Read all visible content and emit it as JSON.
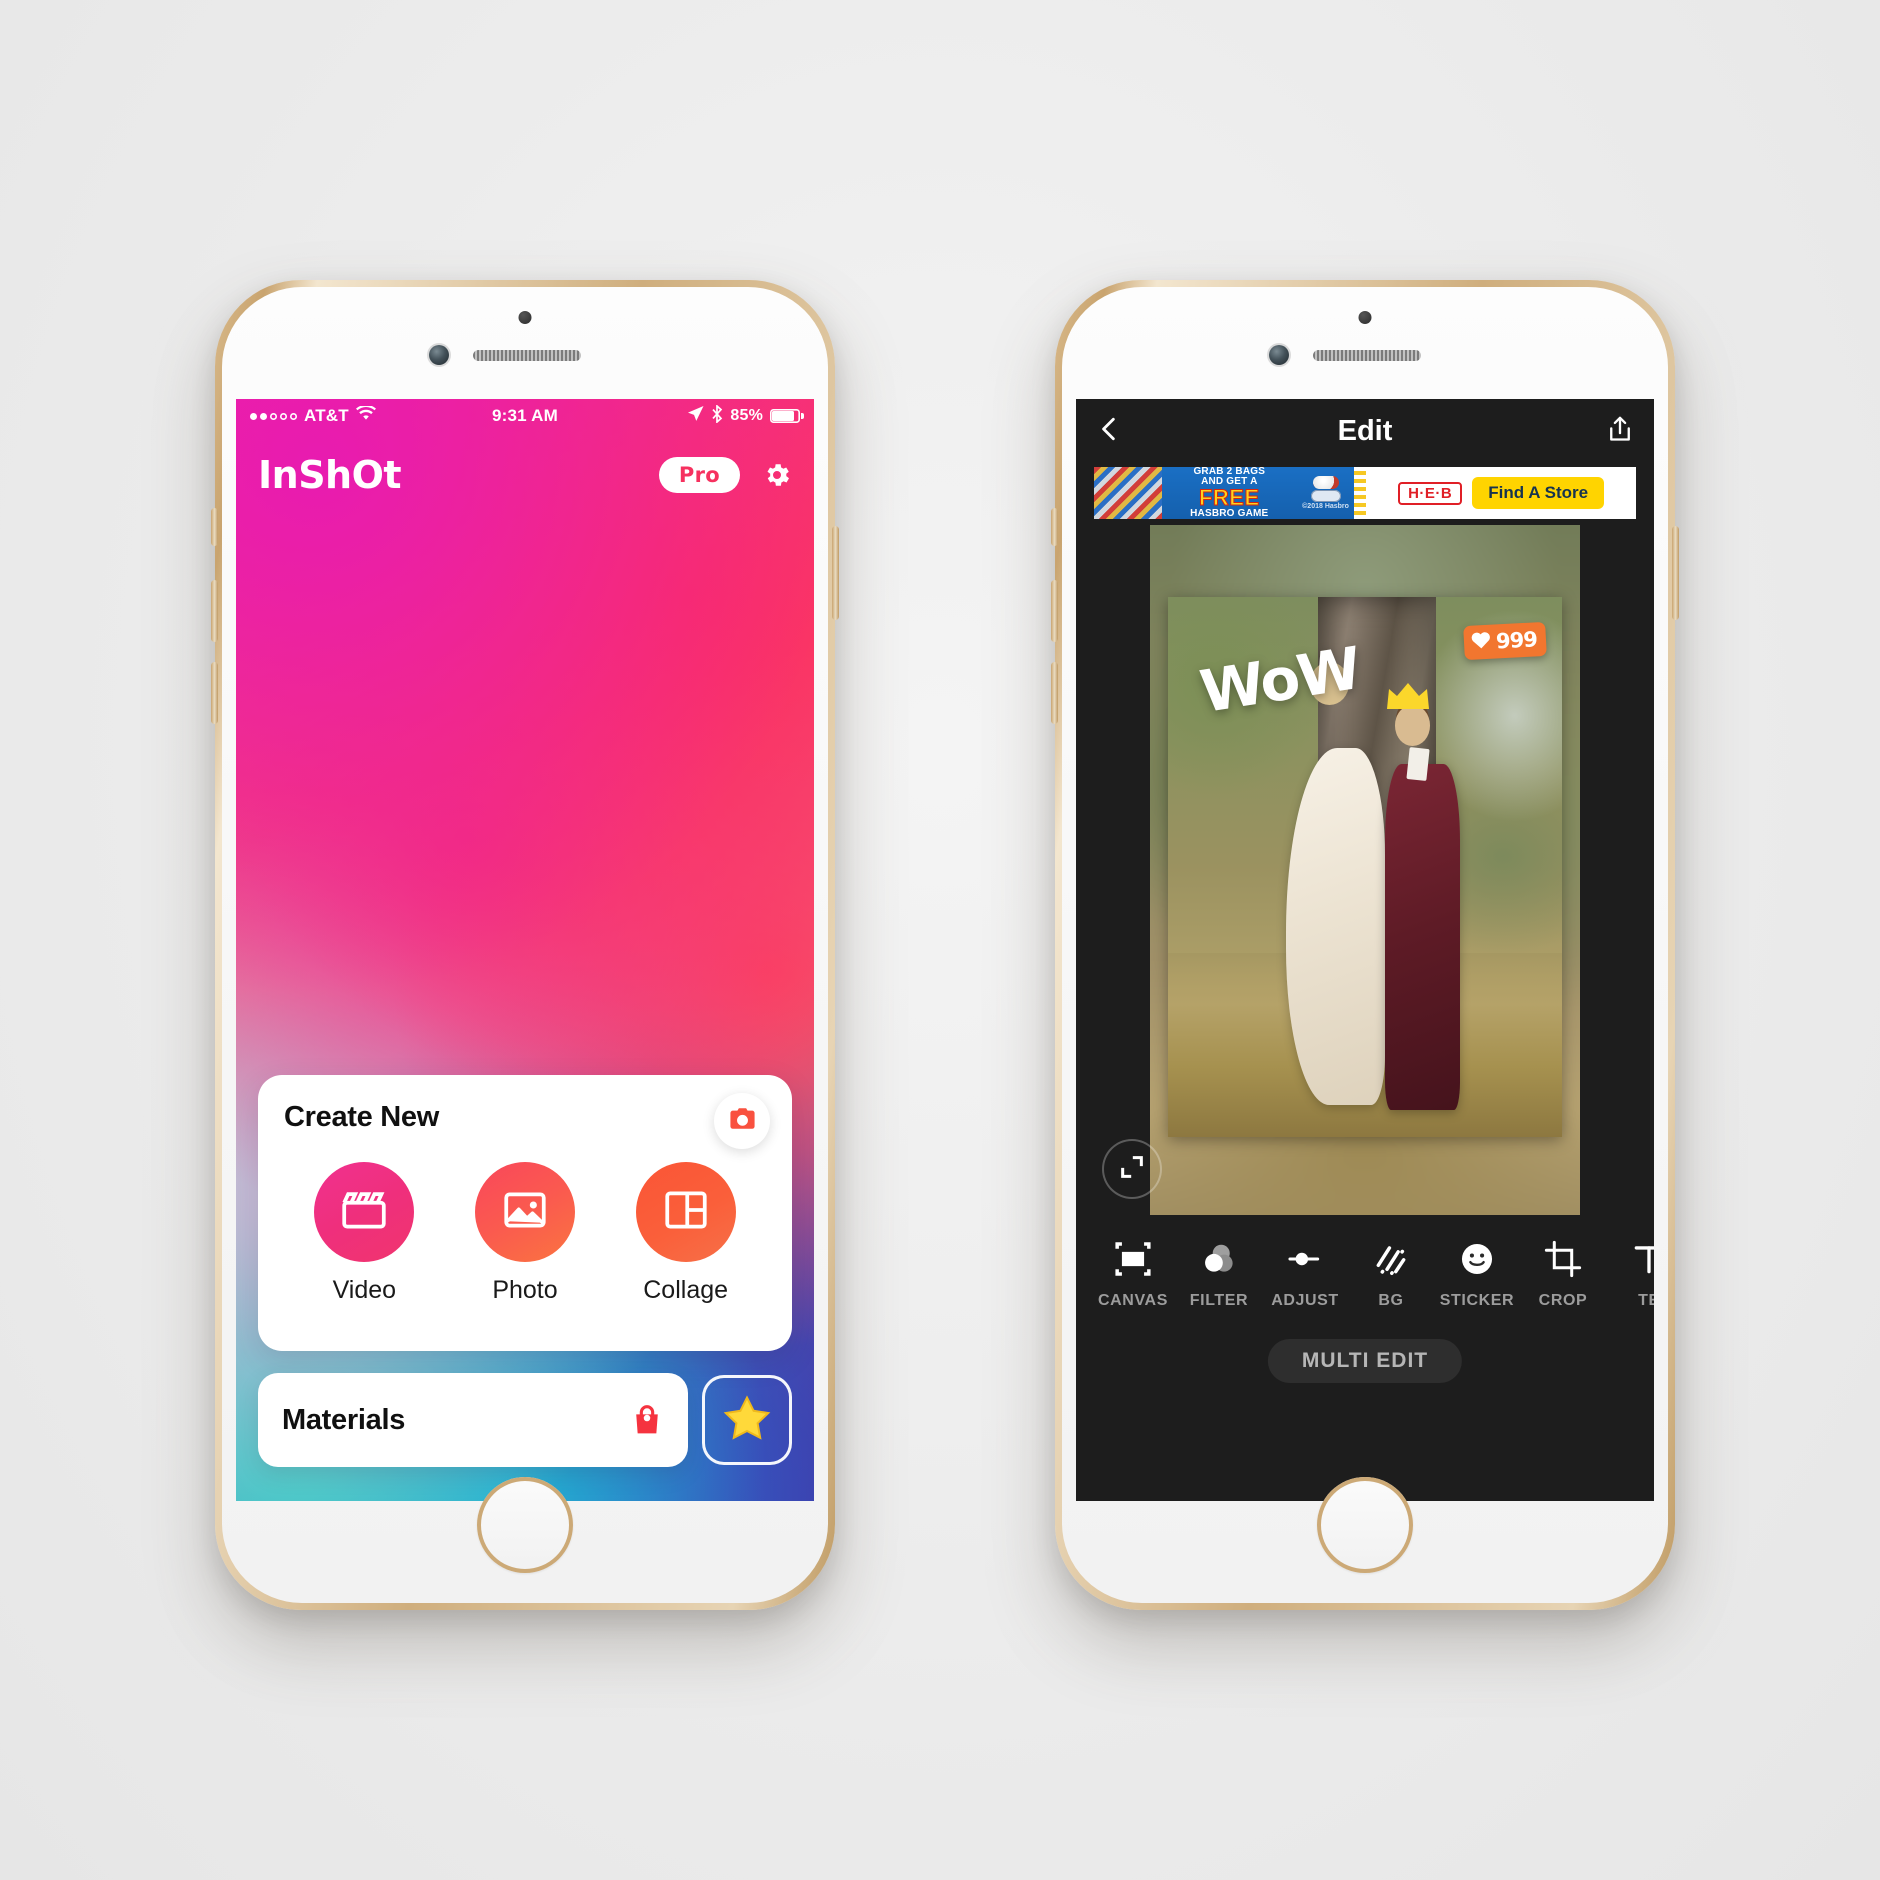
{
  "left_phone": {
    "status_bar": {
      "signal_dots_filled": 2,
      "signal_dots_total": 5,
      "carrier": "AT&T",
      "wifi_icon": "wifi-icon",
      "time": "9:31 AM",
      "location_icon": "location-arrow-icon",
      "bluetooth_icon": "bluetooth-icon",
      "battery_percent": "85%",
      "battery_level": 85
    },
    "header": {
      "logo": "InShOt",
      "pro_label": "Pro",
      "settings_icon": "gear-icon"
    },
    "create_card": {
      "title": "Create New",
      "camera_icon": "camera-icon",
      "actions": [
        {
          "label": "Video",
          "icon": "clapperboard-icon",
          "color": "#f0318f"
        },
        {
          "label": "Photo",
          "icon": "image-icon",
          "color": "#fa5a4f"
        },
        {
          "label": "Collage",
          "icon": "grid-layout-icon",
          "color": "#fb5536"
        }
      ]
    },
    "materials": {
      "label": "Materials",
      "shop_icon": "shopping-bag-icon",
      "star_icon": "star-icon"
    }
  },
  "right_phone": {
    "header": {
      "back_icon": "chevron-left-icon",
      "title": "Edit",
      "share_icon": "share-icon"
    },
    "ad": {
      "line1": "GRAB 2 BAGS",
      "line2": "AND GET A",
      "free": "FREE",
      "line3": "HASBRO GAME",
      "copyright": "©2018 Hasbro",
      "store_logo": "H·E·B",
      "cta": "Find A Store",
      "cta_color": "#ffd400"
    },
    "canvas": {
      "stickers": {
        "wow_text": "WoW",
        "like_count": "999",
        "like_icon": "heart-icon",
        "like_color": "#f2762f",
        "crown_icon": "crown-icon",
        "crown_color": "#fbd72b"
      },
      "fullscreen_icon": "expand-icon"
    },
    "toolbar": [
      {
        "label": "CANVAS",
        "icon": "canvas-frame-icon"
      },
      {
        "label": "FILTER",
        "icon": "filter-circles-icon"
      },
      {
        "label": "ADJUST",
        "icon": "slider-icon"
      },
      {
        "label": "BG",
        "icon": "diagonal-stripes-icon"
      },
      {
        "label": "STICKER",
        "icon": "smiley-icon"
      },
      {
        "label": "CROP",
        "icon": "crop-icon"
      },
      {
        "label": "TE",
        "icon": "text-icon"
      }
    ],
    "multi_edit_label": "MULTI EDIT"
  }
}
